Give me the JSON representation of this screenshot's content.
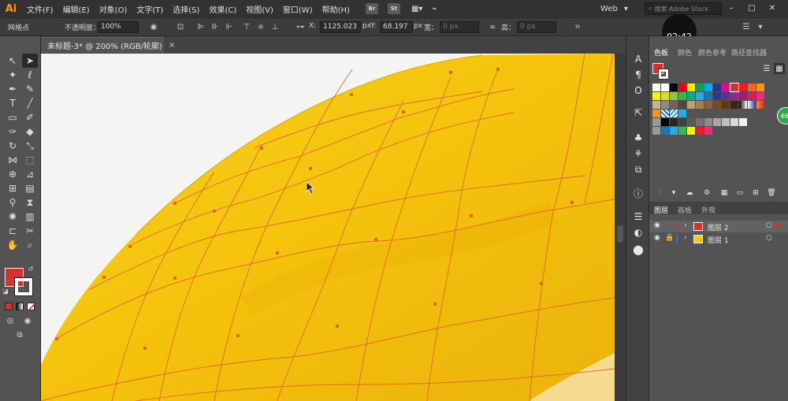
{
  "app": {
    "logo": "Ai"
  },
  "menu": [
    "文件(F)",
    "编辑(E)",
    "对象(O)",
    "文字(T)",
    "选择(S)",
    "效果(C)",
    "视图(V)",
    "窗口(W)",
    "帮助(H)"
  ],
  "menu_icons": {
    "br": "Br",
    "st": "St"
  },
  "workspace": "Web",
  "search": {
    "placeholder": "搜索 Adobe Stock"
  },
  "control": {
    "tool_label": "网格点",
    "opacity_label": "不透明度：",
    "opacity_value": "100%",
    "x_label": "X:",
    "x_value": "1125.023",
    "y_label": "Y:",
    "y_value": "68.197",
    "unit": "px",
    "w_label": "宽：",
    "w_value": "0 px",
    "h_label": "高：",
    "h_value": "0 px"
  },
  "timer": "02:42",
  "document_tab": {
    "title": "未标题-3* @ 200% (RGB/轮廓)",
    "close": "×"
  },
  "swatches_panel": {
    "tabs": [
      "色板",
      "颜色",
      "颜色参考",
      "路径查找器"
    ],
    "active_tab": "色板"
  },
  "layers_panel": {
    "tabs": [
      "图层",
      "画板",
      "外观"
    ],
    "active_tab": "图层",
    "layers": [
      {
        "name": "图层 2",
        "color": "#d0342c",
        "selected": true
      },
      {
        "name": "图层 1",
        "color": "#3a6ed0",
        "selected": false
      }
    ]
  },
  "badge": "66",
  "colors": {
    "fill": "#d0342c",
    "mesh_line": "#e8642a",
    "object_fill": "#f6c90e"
  }
}
